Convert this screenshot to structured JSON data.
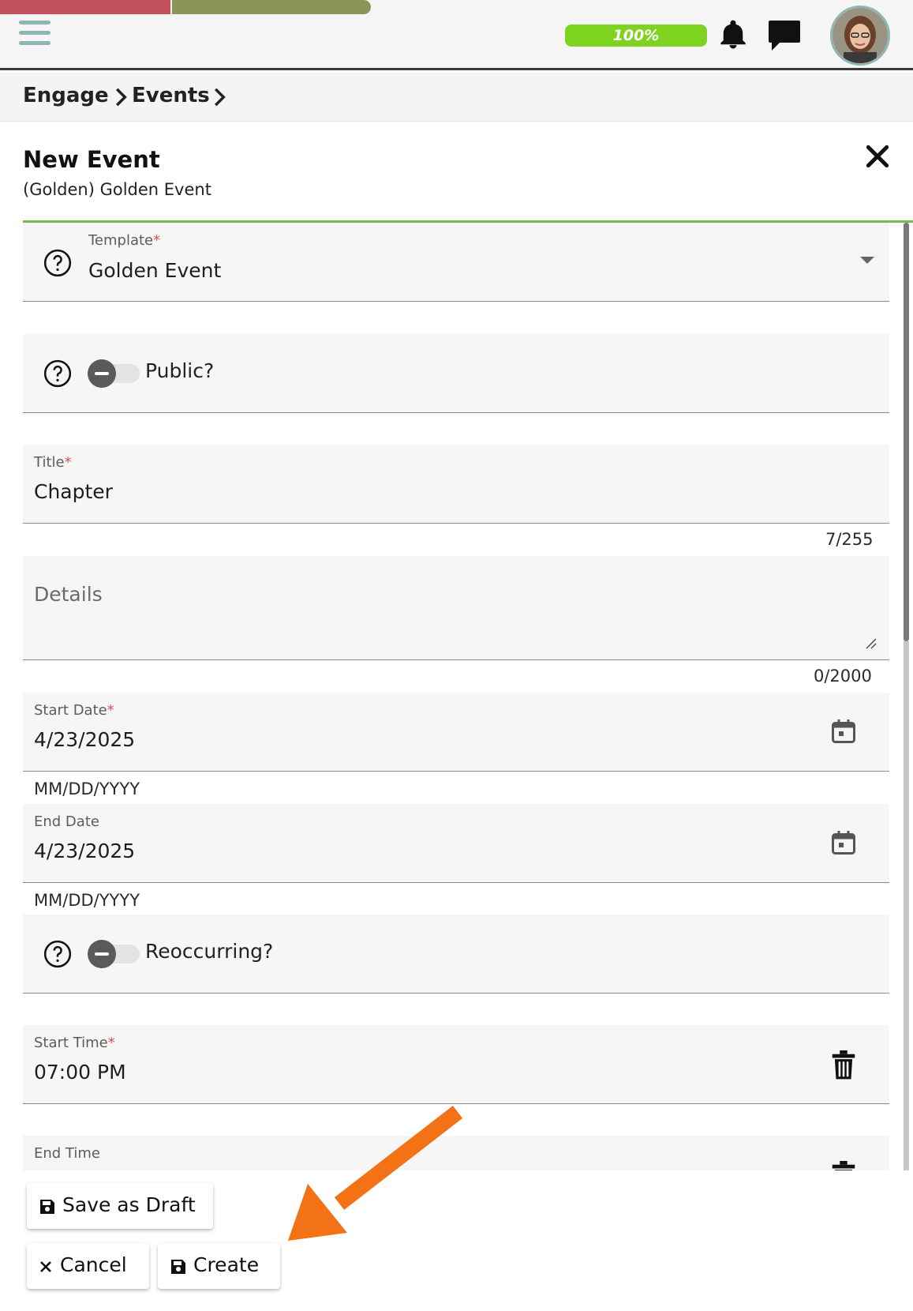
{
  "header": {
    "progress_text": "100%",
    "progress_value": 1.0,
    "icons": [
      "menu-icon",
      "bell-icon",
      "chat-icon",
      "avatar"
    ]
  },
  "breadcrumb": {
    "items": [
      "Engage",
      "Events"
    ]
  },
  "page": {
    "title": "New Event",
    "subtitle": "(Golden) Golden Event"
  },
  "form": {
    "template": {
      "label": "Template",
      "value": "Golden Event"
    },
    "public": {
      "label": "Public?",
      "on": false
    },
    "title": {
      "label": "Title",
      "value": "Chapter",
      "counter": "7/255"
    },
    "details": {
      "placeholder": "Details",
      "counter": "0/2000"
    },
    "start_date": {
      "label": "Start Date",
      "value": "4/23/2025",
      "hint": "MM/DD/YYYY"
    },
    "end_date": {
      "label": "End Date",
      "value": "4/23/2025",
      "hint": "MM/DD/YYYY"
    },
    "reoccurring": {
      "label": "Reoccurring?",
      "on": false
    },
    "start_time": {
      "label": "Start Time",
      "value": "07:00 PM"
    },
    "end_time": {
      "label": "End Time"
    },
    "required_mark": "*"
  },
  "actions": {
    "save_draft": "Save as Draft",
    "cancel": "Cancel",
    "create": "Create"
  },
  "colors": {
    "accent_green": "#7ed321",
    "rule_green": "#6fbf52",
    "stripe_red": "#c2505a",
    "stripe_olive": "#8a9655",
    "arrow_orange": "#f47216",
    "menu_teal": "#8fb6b1"
  }
}
